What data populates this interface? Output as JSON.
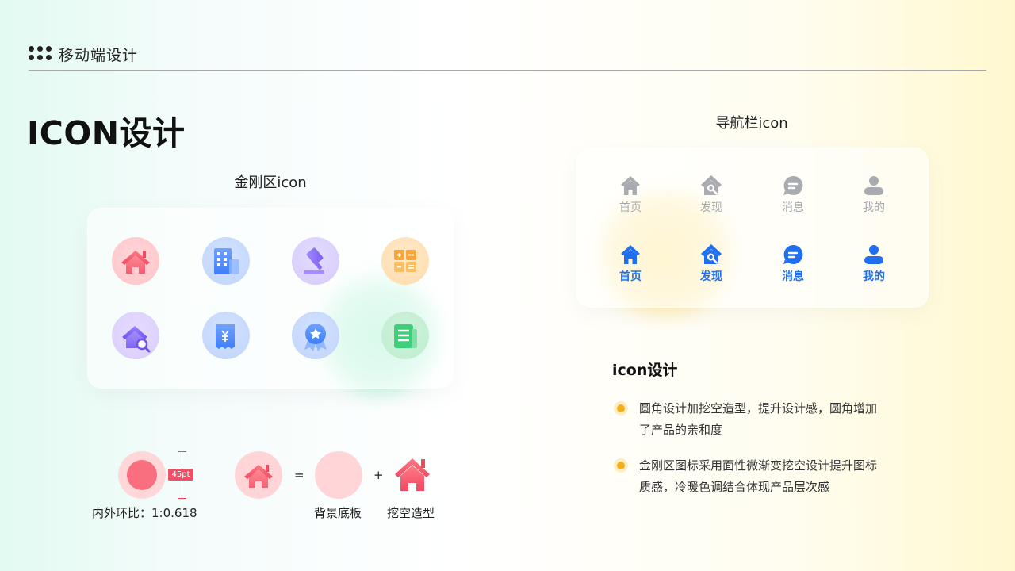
{
  "header": {
    "brand": "移动端设计"
  },
  "page_title": "ICON设计",
  "kingkong": {
    "label": "金刚区icon"
  },
  "navbar": {
    "label": "导航栏icon",
    "items": [
      {
        "label": "首页",
        "icon": "home-icon"
      },
      {
        "label": "发现",
        "icon": "discover-icon"
      },
      {
        "label": "消息",
        "icon": "message-icon"
      },
      {
        "label": "我的",
        "icon": "profile-icon"
      }
    ]
  },
  "design_notes": {
    "heading": "icon设计",
    "points": [
      {
        "line1": "圆角设计加挖空造型，提升设计感，圆角增加",
        "line2": "了产品的亲和度"
      },
      {
        "line1": "金刚区图标采用面性微渐变挖空设计提升图标",
        "line2": "质感，冷暖色调结合体现产品层次感"
      }
    ]
  },
  "construction": {
    "size_tag": "45pt",
    "ratio_label": "内外环比：1:0.618",
    "equals": "=",
    "plus": "+",
    "bg_label": "背景底板",
    "cutout_label": "挖空造型"
  },
  "colors": {
    "nav_active": "#1f6ff0",
    "nav_inactive": "#a6a8ad",
    "bullet": "#f3b01c",
    "accent_red": "#ef4f65"
  }
}
